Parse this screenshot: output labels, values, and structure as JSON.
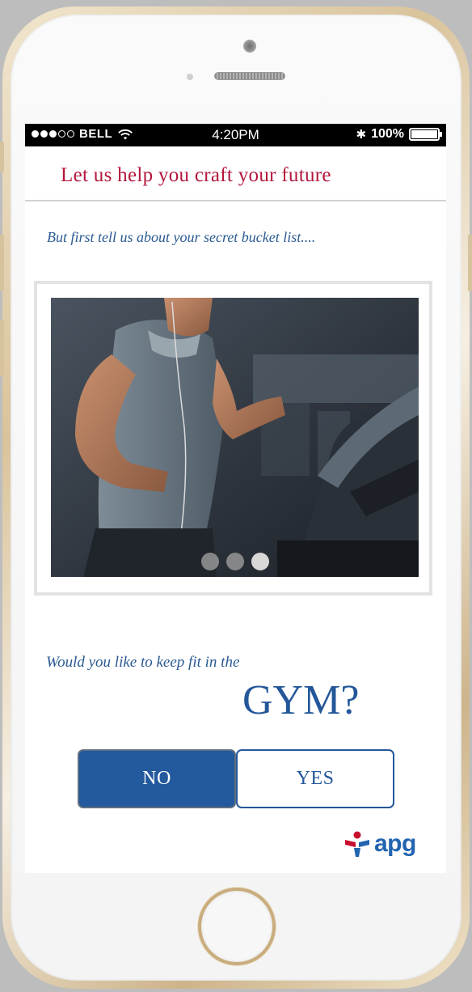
{
  "status_bar": {
    "carrier": "BELL",
    "time": "4:20PM",
    "battery": "100%",
    "signal_bars_filled": 3,
    "signal_bars_total": 5
  },
  "header": {
    "title": "Let us help you craft your future"
  },
  "intro": {
    "text": "But first tell us about your secret bucket list...."
  },
  "carousel": {
    "image_subject": "man running on treadmill in gym",
    "slide_count": 3,
    "active_slide": 3
  },
  "question": {
    "prompt": "Would you like to keep fit in the",
    "activity": "GYM?"
  },
  "actions": {
    "no_label": "NO",
    "yes_label": "YES"
  },
  "brand": {
    "name": "apg",
    "primary_color": "#2264b0",
    "accent_color": "#c8102e"
  },
  "colors": {
    "title_red": "#b3173b",
    "text_blue": "#2a5a93",
    "button_blue": "#23599d"
  }
}
